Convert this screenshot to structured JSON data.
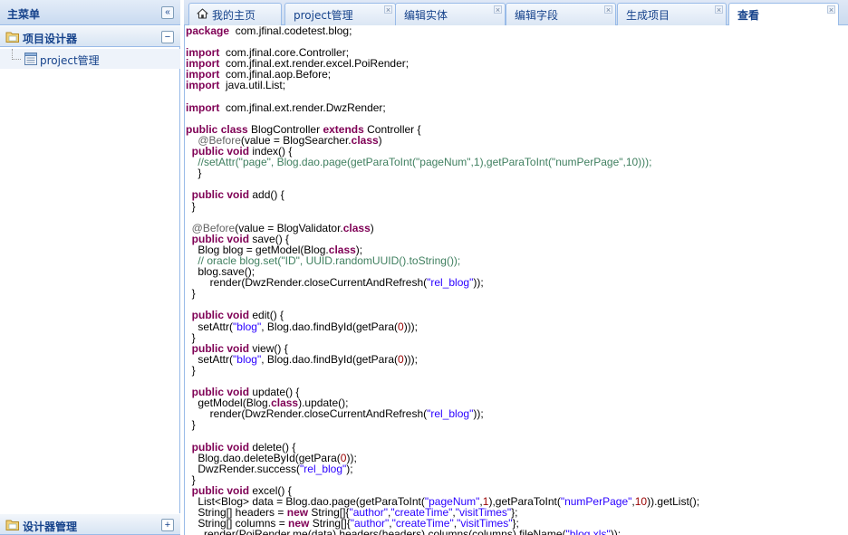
{
  "sidebar": {
    "title": "主菜单",
    "collapse_symbol": "«",
    "sections": [
      {
        "label": "项目设计器",
        "toggle": "−",
        "items": [
          {
            "label": "project管理"
          }
        ]
      },
      {
        "label": "设计器管理",
        "toggle": "+"
      }
    ]
  },
  "tabs": [
    {
      "label": "我的主页",
      "icon": "home-icon",
      "closable": false,
      "active": false
    },
    {
      "label": "project管理",
      "closable": true,
      "active": false
    },
    {
      "label": "编辑实体",
      "closable": true,
      "active": false
    },
    {
      "label": "编辑字段",
      "closable": true,
      "active": false
    },
    {
      "label": "生成项目",
      "closable": true,
      "active": false
    },
    {
      "label": "查看",
      "closable": true,
      "active": true
    }
  ],
  "close_symbol": "×",
  "code_lines": [
    [
      [
        "kw",
        "package"
      ],
      [
        "",
        "  com.jfinal.codetest.blog;"
      ]
    ],
    [],
    [
      [
        "kw",
        "import"
      ],
      [
        "",
        "  com.jfinal.core.Controller;"
      ]
    ],
    [
      [
        "kw",
        "import"
      ],
      [
        "",
        "  com.jfinal.ext.render.excel.PoiRender;"
      ]
    ],
    [
      [
        "kw",
        "import"
      ],
      [
        "",
        "  com.jfinal.aop.Before;"
      ]
    ],
    [
      [
        "kw",
        "import"
      ],
      [
        "",
        "  java.util.List;"
      ]
    ],
    [],
    [
      [
        "kw",
        "import"
      ],
      [
        "",
        "  com.jfinal.ext.render.DwzRender;"
      ]
    ],
    [],
    [
      [
        "kw",
        "public"
      ],
      [
        "",
        " "
      ],
      [
        "kw",
        "class"
      ],
      [
        "",
        " BlogController "
      ],
      [
        "kw",
        "extends"
      ],
      [
        "",
        " Controller {"
      ]
    ],
    [
      [
        "",
        "    "
      ],
      [
        "an",
        "@Before"
      ],
      [
        "",
        "(value = BlogSearcher."
      ],
      [
        "kw",
        "class"
      ],
      [
        "",
        ")"
      ]
    ],
    [
      [
        "",
        "  "
      ],
      [
        "kw",
        "public"
      ],
      [
        "",
        " "
      ],
      [
        "kw",
        "void"
      ],
      [
        "",
        " index() {"
      ]
    ],
    [
      [
        "",
        "    "
      ],
      [
        "cm",
        "//setAttr(\"page\", Blog.dao.page(getParaToInt(\"pageNum\",1),getParaToInt(\"numPerPage\",10)));"
      ]
    ],
    [
      [
        "",
        "    }"
      ]
    ],
    [],
    [
      [
        "",
        "  "
      ],
      [
        "kw",
        "public"
      ],
      [
        "",
        " "
      ],
      [
        "kw",
        "void"
      ],
      [
        "",
        " add() {"
      ]
    ],
    [
      [
        "",
        "  }"
      ]
    ],
    [],
    [
      [
        "",
        "  "
      ],
      [
        "an",
        "@Before"
      ],
      [
        "",
        "(value = BlogValidator."
      ],
      [
        "kw",
        "class"
      ],
      [
        "",
        ")"
      ]
    ],
    [
      [
        "",
        "  "
      ],
      [
        "kw",
        "public"
      ],
      [
        "",
        " "
      ],
      [
        "kw",
        "void"
      ],
      [
        "",
        " save() {"
      ]
    ],
    [
      [
        "",
        "    Blog blog = getModel(Blog."
      ],
      [
        "kw",
        "class"
      ],
      [
        "",
        ");"
      ]
    ],
    [
      [
        "",
        "    "
      ],
      [
        "cm",
        "// oracle blog.set(\"ID\", UUID.randomUUID().toString());"
      ]
    ],
    [
      [
        "",
        "    blog.save();"
      ]
    ],
    [
      [
        "",
        "        render(DwzRender.closeCurrentAndRefresh("
      ],
      [
        "str",
        "\"rel_blog\""
      ],
      [
        "",
        "));"
      ]
    ],
    [
      [
        "",
        "  }"
      ]
    ],
    [],
    [
      [
        "",
        "  "
      ],
      [
        "kw",
        "public"
      ],
      [
        "",
        " "
      ],
      [
        "kw",
        "void"
      ],
      [
        "",
        " edit() {"
      ]
    ],
    [
      [
        "",
        "    setAttr("
      ],
      [
        "str",
        "\"blog\""
      ],
      [
        "",
        ", Blog.dao.findById(getPara("
      ],
      [
        "num",
        "0"
      ],
      [
        "",
        ")));"
      ]
    ],
    [
      [
        "",
        "  }"
      ]
    ],
    [
      [
        "",
        "  "
      ],
      [
        "kw",
        "public"
      ],
      [
        "",
        " "
      ],
      [
        "kw",
        "void"
      ],
      [
        "",
        " view() {"
      ]
    ],
    [
      [
        "",
        "    setAttr("
      ],
      [
        "str",
        "\"blog\""
      ],
      [
        "",
        ", Blog.dao.findById(getPara("
      ],
      [
        "num",
        "0"
      ],
      [
        "",
        ")));"
      ]
    ],
    [
      [
        "",
        "  }"
      ]
    ],
    [],
    [
      [
        "",
        "  "
      ],
      [
        "kw",
        "public"
      ],
      [
        "",
        " "
      ],
      [
        "kw",
        "void"
      ],
      [
        "",
        " update() {"
      ]
    ],
    [
      [
        "",
        "    getModel(Blog."
      ],
      [
        "kw",
        "class"
      ],
      [
        "",
        ").update();"
      ]
    ],
    [
      [
        "",
        "        render(DwzRender.closeCurrentAndRefresh("
      ],
      [
        "str",
        "\"rel_blog\""
      ],
      [
        "",
        "));"
      ]
    ],
    [
      [
        "",
        "  }"
      ]
    ],
    [],
    [
      [
        "",
        "  "
      ],
      [
        "kw",
        "public"
      ],
      [
        "",
        " "
      ],
      [
        "kw",
        "void"
      ],
      [
        "",
        " delete() {"
      ]
    ],
    [
      [
        "",
        "    Blog.dao.deleteById(getPara("
      ],
      [
        "num",
        "0"
      ],
      [
        "",
        "));"
      ]
    ],
    [
      [
        "",
        "    DwzRender.success("
      ],
      [
        "str",
        "\"rel_blog\""
      ],
      [
        "",
        ");"
      ]
    ],
    [
      [
        "",
        "  }"
      ]
    ],
    [
      [
        "",
        "  "
      ],
      [
        "kw",
        "public"
      ],
      [
        "",
        " "
      ],
      [
        "kw",
        "void"
      ],
      [
        "",
        " excel() {"
      ]
    ],
    [
      [
        "",
        "    List<Blog> data = Blog.dao.page(getParaToInt("
      ],
      [
        "str",
        "\"pageNum\""
      ],
      [
        "",
        ","
      ],
      [
        "num",
        "1"
      ],
      [
        "",
        "),getParaToInt("
      ],
      [
        "str",
        "\"numPerPage\""
      ],
      [
        "",
        ","
      ],
      [
        "num",
        "10"
      ],
      [
        "",
        ")).getList();"
      ]
    ],
    [
      [
        "",
        "    String[] headers = "
      ],
      [
        "kw",
        "new"
      ],
      [
        "",
        " String[]{"
      ],
      [
        "str",
        "\"author\""
      ],
      [
        "",
        ","
      ],
      [
        "str",
        "\"createTime\""
      ],
      [
        "",
        ","
      ],
      [
        "str",
        "\"visitTimes\""
      ],
      [
        "",
        "};"
      ]
    ],
    [
      [
        "",
        "    String[] columns = "
      ],
      [
        "kw",
        "new"
      ],
      [
        "",
        " String[]{"
      ],
      [
        "str",
        "\"author\""
      ],
      [
        "",
        ","
      ],
      [
        "str",
        "\"createTime\""
      ],
      [
        "",
        ","
      ],
      [
        "str",
        "\"visitTimes\""
      ],
      [
        "",
        "};"
      ]
    ],
    [
      [
        "",
        "      render(PoiRender.me(data).headers(headers).columns(columns).fileName("
      ],
      [
        "str",
        "\"blog.xls\""
      ],
      [
        "",
        "));"
      ]
    ]
  ]
}
